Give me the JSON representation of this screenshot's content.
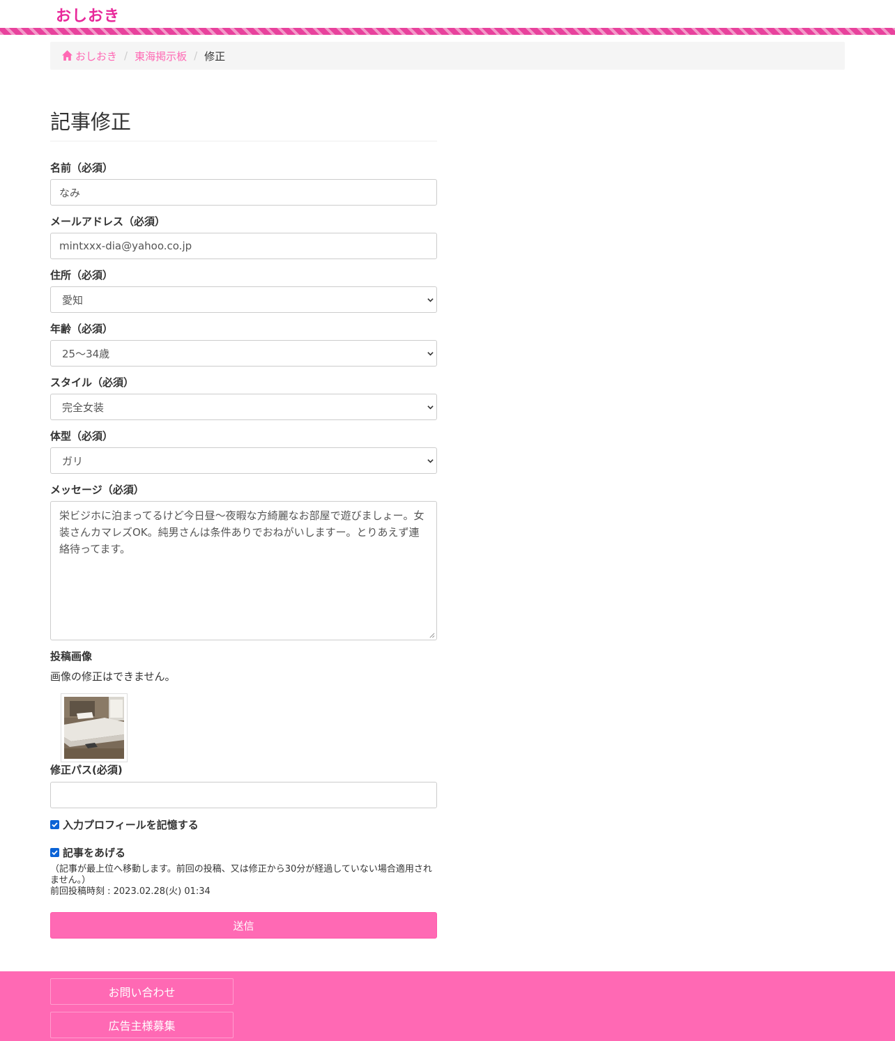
{
  "header": {
    "logo": "おしおき"
  },
  "breadcrumb": {
    "home": "おしおき",
    "board": "東海掲示板",
    "current": "修正"
  },
  "form": {
    "title": "記事修正",
    "name": {
      "label": "名前（必須）",
      "value": "なみ"
    },
    "email": {
      "label": "メールアドレス（必須）",
      "value": "mintxxx-dia@yahoo.co.jp"
    },
    "address": {
      "label": "住所（必須）",
      "value": "愛知"
    },
    "age": {
      "label": "年齢（必須）",
      "value": "25〜34歳"
    },
    "style": {
      "label": "スタイル（必須）",
      "value": "完全女装"
    },
    "body_type": {
      "label": "体型（必須）",
      "value": "ガリ"
    },
    "message": {
      "label": "メッセージ（必須）",
      "value": "栄ビジホに泊まってるけど今日昼〜夜暇な方綺麗なお部屋で遊びましょー。女装さんカマレズOK。純男さんは条件ありでおねがいしますー。とりあえず連絡待ってます。"
    },
    "image": {
      "label": "投稿画像",
      "note": "画像の修正はできません。"
    },
    "password": {
      "label": "修正パス(必須)",
      "value": ""
    },
    "remember": {
      "label": "入力プロフィールを記憶する",
      "checked": true
    },
    "bump": {
      "label": "記事をあげる",
      "checked": true,
      "note": "（記事が最上位へ移動します。前回の投稿、又は修正から30分が経過していない場合適用されません。）",
      "last_posted": "前回投稿時刻 : 2023.02.28(火) 01:34"
    },
    "submit_label": "送信"
  },
  "footer": {
    "contact": "お問い合わせ",
    "advertise": "広告主様募集"
  },
  "colors": {
    "accent": "#ff69b4",
    "logo": "#e8289a",
    "checkbox": "#0b63d6"
  }
}
